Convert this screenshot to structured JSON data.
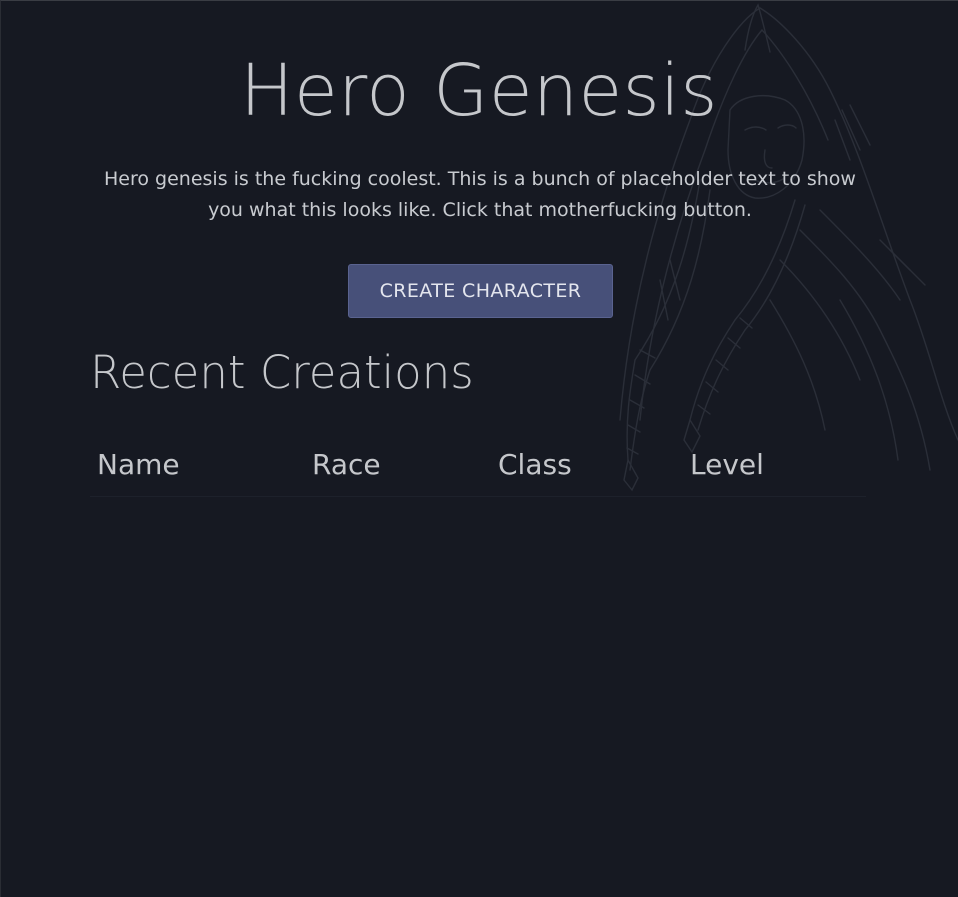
{
  "hero": {
    "title": "Hero Genesis",
    "intro": "Hero genesis is the fucking coolest. This is a bunch of placeholder text to show you what this looks like. Click that motherfucking button.",
    "cta_label": "CREATE CHARACTER"
  },
  "recent": {
    "title": "Recent Creations",
    "columns": [
      "Name",
      "Race",
      "Class",
      "Level"
    ],
    "rows": []
  },
  "colors": {
    "background": "#161922",
    "text": "#c5c7cb",
    "button": "#475079"
  },
  "icons": {
    "background_art": "hooded-character-sketch"
  }
}
